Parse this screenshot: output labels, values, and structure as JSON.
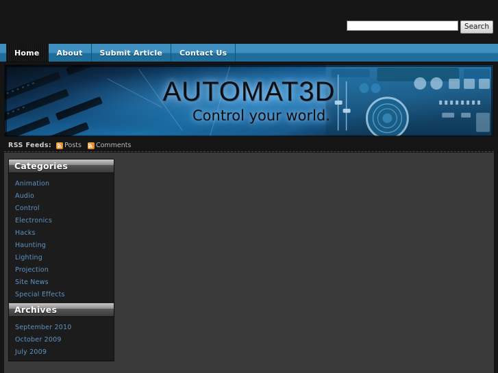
{
  "site": {
    "title": "AUTOMAT3D",
    "tagline": "Control your world.",
    "accent_blue": "#3f90c1",
    "accent_blue_dark": "#1f6d9b",
    "link_blue": "#5f94c4",
    "rss_orange": "#e8801a",
    "page_bg": "#151515",
    "content_bg": "#3a3a3a",
    "sidebar_bg": "#1c1c1c"
  },
  "search": {
    "value": "",
    "placeholder": "",
    "button_label": "Search"
  },
  "nav": {
    "items": [
      {
        "label": "Home",
        "active": true
      },
      {
        "label": "About",
        "active": false
      },
      {
        "label": "Submit Article",
        "active": false
      },
      {
        "label": "Contact Us",
        "active": false
      }
    ]
  },
  "rss": {
    "label": "RSS Feeds:",
    "links": [
      {
        "label": "Posts",
        "icon": "rss-icon"
      },
      {
        "label": "Comments",
        "icon": "rss-icon"
      }
    ]
  },
  "sidebar": {
    "widgets": [
      {
        "title": "Categories",
        "items": [
          "Animation",
          "Audio",
          "Control",
          "Electronics",
          "Hacks",
          "Haunting",
          "Lighting",
          "Projection",
          "Site News",
          "Special Effects"
        ]
      },
      {
        "title": "Archives",
        "items": [
          "September 2010",
          "October 2009",
          "July 2009"
        ]
      }
    ]
  },
  "main": {
    "content": ""
  }
}
